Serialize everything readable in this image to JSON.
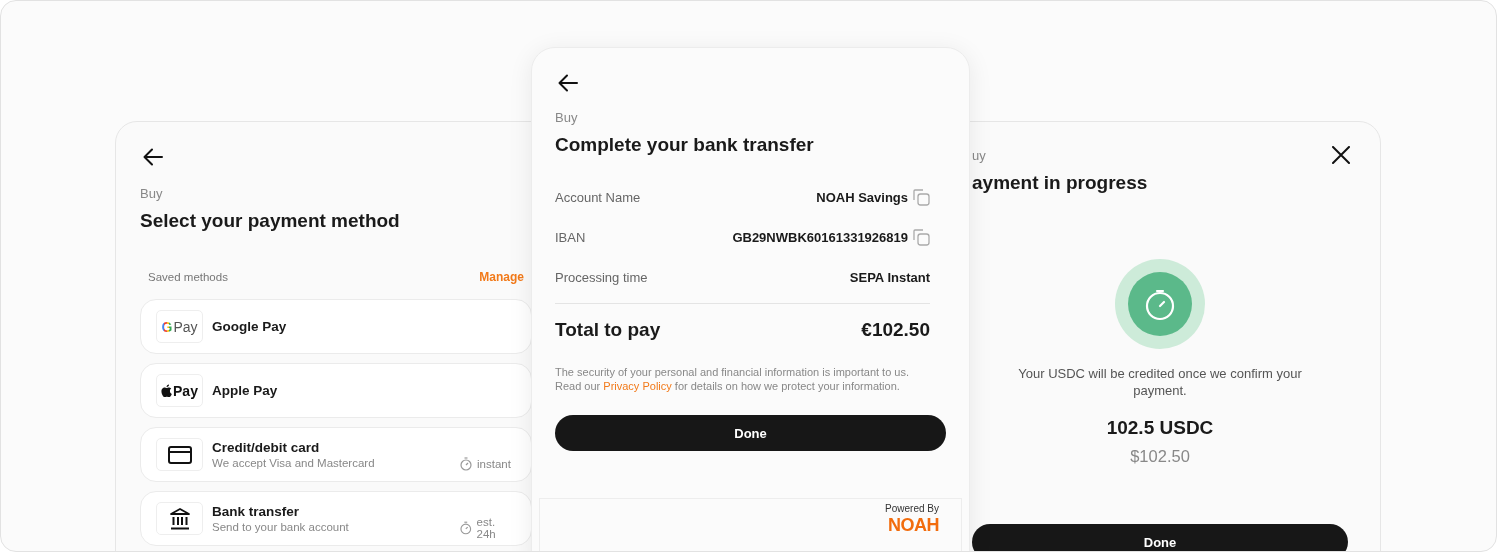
{
  "left_panel": {
    "eyebrow": "Buy",
    "title": "Select your payment method",
    "section_label": "Saved methods",
    "manage_link": "Manage",
    "methods": [
      {
        "kind": "google",
        "mark": "G",
        "logo_text": "Pay",
        "name": "Google Pay"
      },
      {
        "kind": "apple",
        "logo_text": "Pay",
        "name": "Apple Pay"
      },
      {
        "kind": "card",
        "name": "Credit/debit card",
        "subtitle": "We accept Visa and Mastercard",
        "speed": "instant"
      },
      {
        "kind": "bank",
        "name": "Bank transfer",
        "subtitle": "Send to your bank account",
        "speed": "est. 24h"
      }
    ]
  },
  "middle_panel": {
    "eyebrow": "Buy",
    "title": "Complete your bank transfer",
    "details": [
      {
        "label": "Account Name",
        "value": "NOAH Savings",
        "copyable": true
      },
      {
        "label": "IBAN",
        "value": "GB29NWBK60161331926819",
        "copyable": true
      },
      {
        "label": "Processing time",
        "value": "SEPA Instant",
        "copyable": false
      }
    ],
    "total_label": "Total to pay",
    "total_value": "€102.50",
    "disclaimer_before": "The security of your personal and financial information is important to us. Read our",
    "disclaimer_link": "Privacy Policy",
    "disclaimer_after": "for details on how we protect your information.",
    "button": "Done",
    "powered_by": "Powered By",
    "brand": "NOAH"
  },
  "right_panel": {
    "eyebrow": "uy",
    "title": "ayment in progress",
    "message": "Your USDC will be credited once we confirm your payment.",
    "amount": "102.5 USDC",
    "fiat_amount": "$102.50",
    "button": "Done"
  }
}
